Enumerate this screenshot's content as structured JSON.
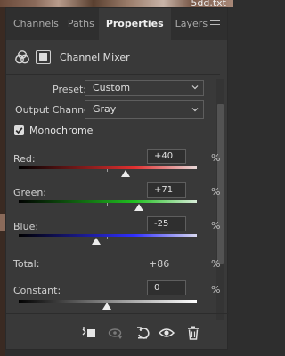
{
  "background": {
    "corner_text": "5dd.txt"
  },
  "tabs": [
    {
      "label": "Channels",
      "active": false
    },
    {
      "label": "Paths",
      "active": false
    },
    {
      "label": "Properties",
      "active": true
    },
    {
      "label": "Layers",
      "active": false
    }
  ],
  "header": {
    "title": "Channel Mixer",
    "adjustment_icon": "channel-mixer-icon",
    "mask_icon": "layer-mask-icon"
  },
  "preset": {
    "label": "Preset:",
    "value": "Custom"
  },
  "output_channel": {
    "label": "Output Channel:",
    "value": "Gray"
  },
  "monochrome": {
    "label": "Monochrome",
    "checked": true
  },
  "channels": {
    "red": {
      "label": "Red:",
      "value": "+40",
      "unit": "%",
      "gradient_color": "#e03030"
    },
    "green": {
      "label": "Green:",
      "value": "+71",
      "unit": "%",
      "gradient_color": "#20c020"
    },
    "blue": {
      "label": "Blue:",
      "value": "-25",
      "unit": "%",
      "gradient_color": "#3030ff"
    }
  },
  "total": {
    "label": "Total:",
    "value": "+86",
    "unit": "%"
  },
  "constant": {
    "label": "Constant:",
    "value": "0",
    "unit": "%"
  },
  "bottom_toolbar": [
    "clip-to-layer-icon",
    "view-previous-state-icon",
    "reset-icon",
    "visibility-eye-icon",
    "trash-icon"
  ],
  "colors": {
    "panel": "#393939",
    "tab_bar": "#2f2f2f",
    "text": "#d6d6d6"
  }
}
